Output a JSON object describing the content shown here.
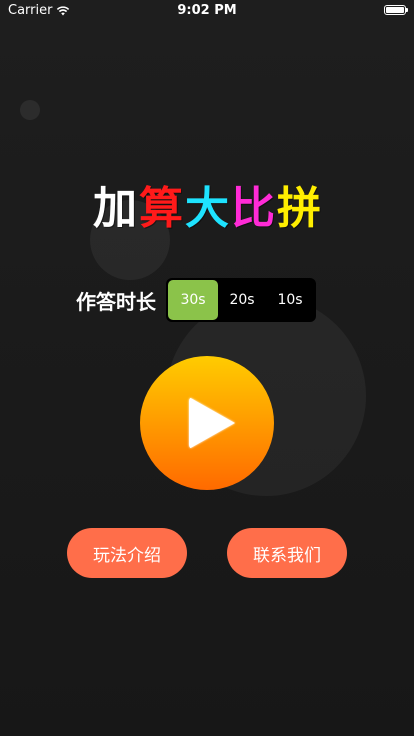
{
  "status_bar": {
    "carrier": "Carrier",
    "time": "9:02 PM"
  },
  "title": {
    "chars": [
      {
        "text": "加",
        "color": "#ffffff"
      },
      {
        "text": "算",
        "color": "#ff1a1a"
      },
      {
        "text": "大",
        "color": "#1ee3ff"
      },
      {
        "text": "比",
        "color": "#ff2bd6"
      },
      {
        "text": "拼",
        "color": "#ffee00"
      }
    ]
  },
  "duration": {
    "label": "作答时长",
    "options": [
      "30s",
      "20s",
      "10s"
    ],
    "selected": "30s",
    "selected_color": "#8bc34a"
  },
  "play_button": {
    "icon": "play-icon",
    "gradient": [
      "#ffcc00",
      "#ff6a00"
    ]
  },
  "buttons": {
    "rules_label": "玩法介绍",
    "contact_label": "联系我们",
    "color": "#ff6e4a"
  }
}
